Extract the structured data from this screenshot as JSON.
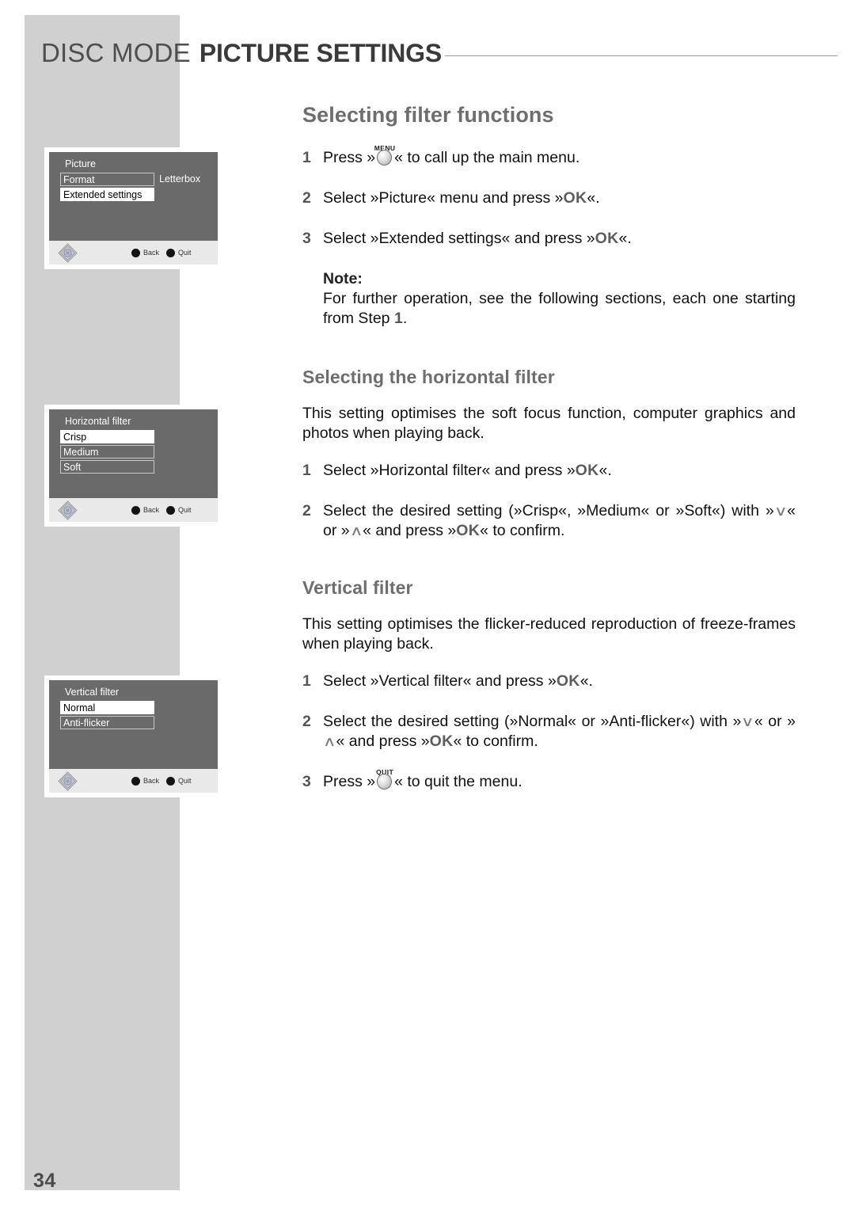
{
  "header": {
    "mode": "DISC MODE",
    "title": "PICTURE SETTINGS"
  },
  "page_number": "34",
  "main": {
    "section_title": "Selecting filter functions",
    "steps_intro": [
      {
        "num": "1",
        "pre": "Press »",
        "icon": "MENU",
        "post": "« to call up the main menu."
      },
      {
        "num": "2",
        "text_a": "Select »Picture« menu and press »",
        "ok": "OK",
        "text_b": "«."
      },
      {
        "num": "3",
        "text_a": "Select »Extended settings« and press »",
        "ok": "OK",
        "text_b": "«."
      }
    ],
    "note": {
      "label": "Note:",
      "text_a": "For further operation, see the following sections, each one starting from Step ",
      "step_ref": "1",
      "text_b": "."
    },
    "horizontal": {
      "title": "Selecting the horizontal filter",
      "intro": "This setting optimises the soft focus function, computer graphics and photos when playing back.",
      "step1": {
        "num": "1",
        "text_a": "Select »Horizontal filter« and press »",
        "ok": "OK",
        "text_b": "«."
      },
      "step2": {
        "num": "2",
        "text_a": "Select the desired setting (»Crisp«, »Medium« or »Soft«) with »",
        "arrow_down": "∨",
        "text_b": "« or »",
        "arrow_up": "∧",
        "text_c": "« and press »",
        "ok": "OK",
        "text_d": "« to confirm."
      }
    },
    "vertical": {
      "title": "Vertical filter",
      "intro": "This setting optimises the flicker-reduced reproduction of freeze-frames when playing back.",
      "step1": {
        "num": "1",
        "text_a": "Select »Vertical filter« and press »",
        "ok": "OK",
        "text_b": "«."
      },
      "step2": {
        "num": "2",
        "text_a": "Select the desired setting (»Normal« or »Anti-flicker«) with »",
        "arrow_down": "∨",
        "text_b": "« or »",
        "arrow_up": "∧",
        "text_c": "« and press »",
        "ok": "OK",
        "text_d": "« to confirm."
      },
      "step3": {
        "num": "3",
        "pre": "Press »",
        "icon": "QUIT",
        "post": "« to quit the menu."
      }
    }
  },
  "osd_menus": [
    {
      "name": "picture-menu",
      "heading": "Picture",
      "rows": [
        {
          "label": "Format",
          "value": "Letterbox",
          "selected": false
        },
        {
          "label": "Extended settings",
          "value": "",
          "selected": true
        }
      ],
      "footer": {
        "back": "Back",
        "quit": "Quit"
      }
    },
    {
      "name": "horizontal-filter-menu",
      "heading": "Horizontal filter",
      "rows": [
        {
          "label": "Crisp",
          "value": "",
          "selected": true
        },
        {
          "label": "Medium",
          "value": "",
          "selected": false
        },
        {
          "label": "Soft",
          "value": "",
          "selected": false
        }
      ],
      "footer": {
        "back": "Back",
        "quit": "Quit"
      }
    },
    {
      "name": "vertical-filter-menu",
      "heading": "Vertical filter",
      "rows": [
        {
          "label": "Normal",
          "value": "",
          "selected": true
        },
        {
          "label": "Anti-flicker",
          "value": "",
          "selected": false
        }
      ],
      "footer": {
        "back": "Back",
        "quit": "Quit"
      }
    }
  ],
  "colors": {
    "sidebar": "#d0d0d0",
    "osd_background": "#6a6a6a",
    "osd_footer": "#e9e9e9",
    "heading_grey": "#6e6e6e"
  }
}
